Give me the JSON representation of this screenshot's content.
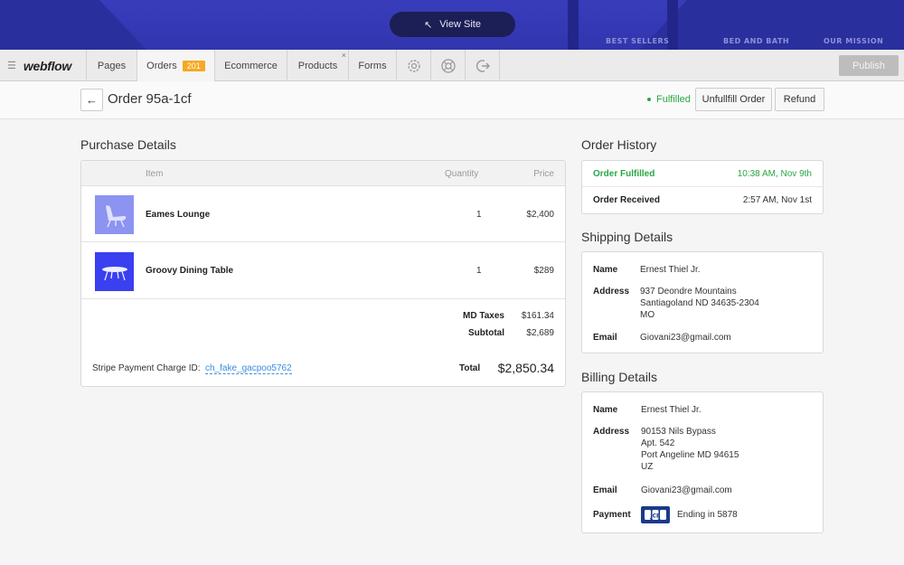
{
  "banner": {
    "view_site_label": "View Site",
    "nav": [
      "BEST SELLERS",
      "BED AND BATH",
      "OUR MISSION"
    ]
  },
  "toolbar": {
    "logo": "webflow",
    "tabs": {
      "pages": "Pages",
      "orders": "Orders",
      "orders_badge": "201",
      "ecommerce": "Ecommerce",
      "products": "Products",
      "forms": "Forms"
    },
    "close_glyph": "×",
    "publish_label": "Publish"
  },
  "order": {
    "title": "Order 95a-1cf",
    "status": "Fulfilled",
    "unfulfill_label": "Unfullfill Order",
    "refund_label": "Refund"
  },
  "purchase": {
    "title": "Purchase Details",
    "columns": {
      "item": "Item",
      "quantity": "Quantity",
      "price": "Price"
    },
    "items": [
      {
        "name": "Eames Lounge",
        "quantity": "1",
        "price": "$2,400"
      },
      {
        "name": "Groovy Dining Table",
        "quantity": "1",
        "price": "$289"
      }
    ],
    "taxes_label": "MD Taxes",
    "taxes_value": "$161.34",
    "subtotal_label": "Subtotal",
    "subtotal_value": "$2,689",
    "total_label": "Total",
    "total_value": "$2,850.34",
    "stripe_label": "Stripe Payment Charge ID:",
    "stripe_id": "ch_fake_gacpoo5762"
  },
  "history": {
    "title": "Order History",
    "entries": [
      {
        "event": "Order Fulfilled",
        "time": "10:38 AM, Nov 9th"
      },
      {
        "event": "Order Received",
        "time": "2:57 AM, Nov 1st"
      }
    ]
  },
  "shipping": {
    "title": "Shipping Details",
    "name_label": "Name",
    "name": "Ernest Thiel Jr.",
    "address_label": "Address",
    "address": [
      "937 Deondre Mountains",
      "Santiagoland ND 34635-2304",
      "MO"
    ],
    "email_label": "Email",
    "email": "Giovani23@gmail.com"
  },
  "billing": {
    "title": "Billing Details",
    "name_label": "Name",
    "name": "Ernest Thiel Jr.",
    "address_label": "Address",
    "address": [
      "90153 Nils Bypass",
      "Apt. 542",
      "Port Angeline MD 94615",
      "UZ"
    ],
    "email_label": "Email",
    "email": "Giovani23@gmail.com",
    "payment_label": "Payment",
    "card_brand": "JCB",
    "payment_text": "Ending in 5878"
  },
  "colors": {
    "accent_green": "#28a745",
    "badge_orange": "#f7a823",
    "banner_blue": "#2a2f9e",
    "link_blue": "#3a8de0"
  }
}
